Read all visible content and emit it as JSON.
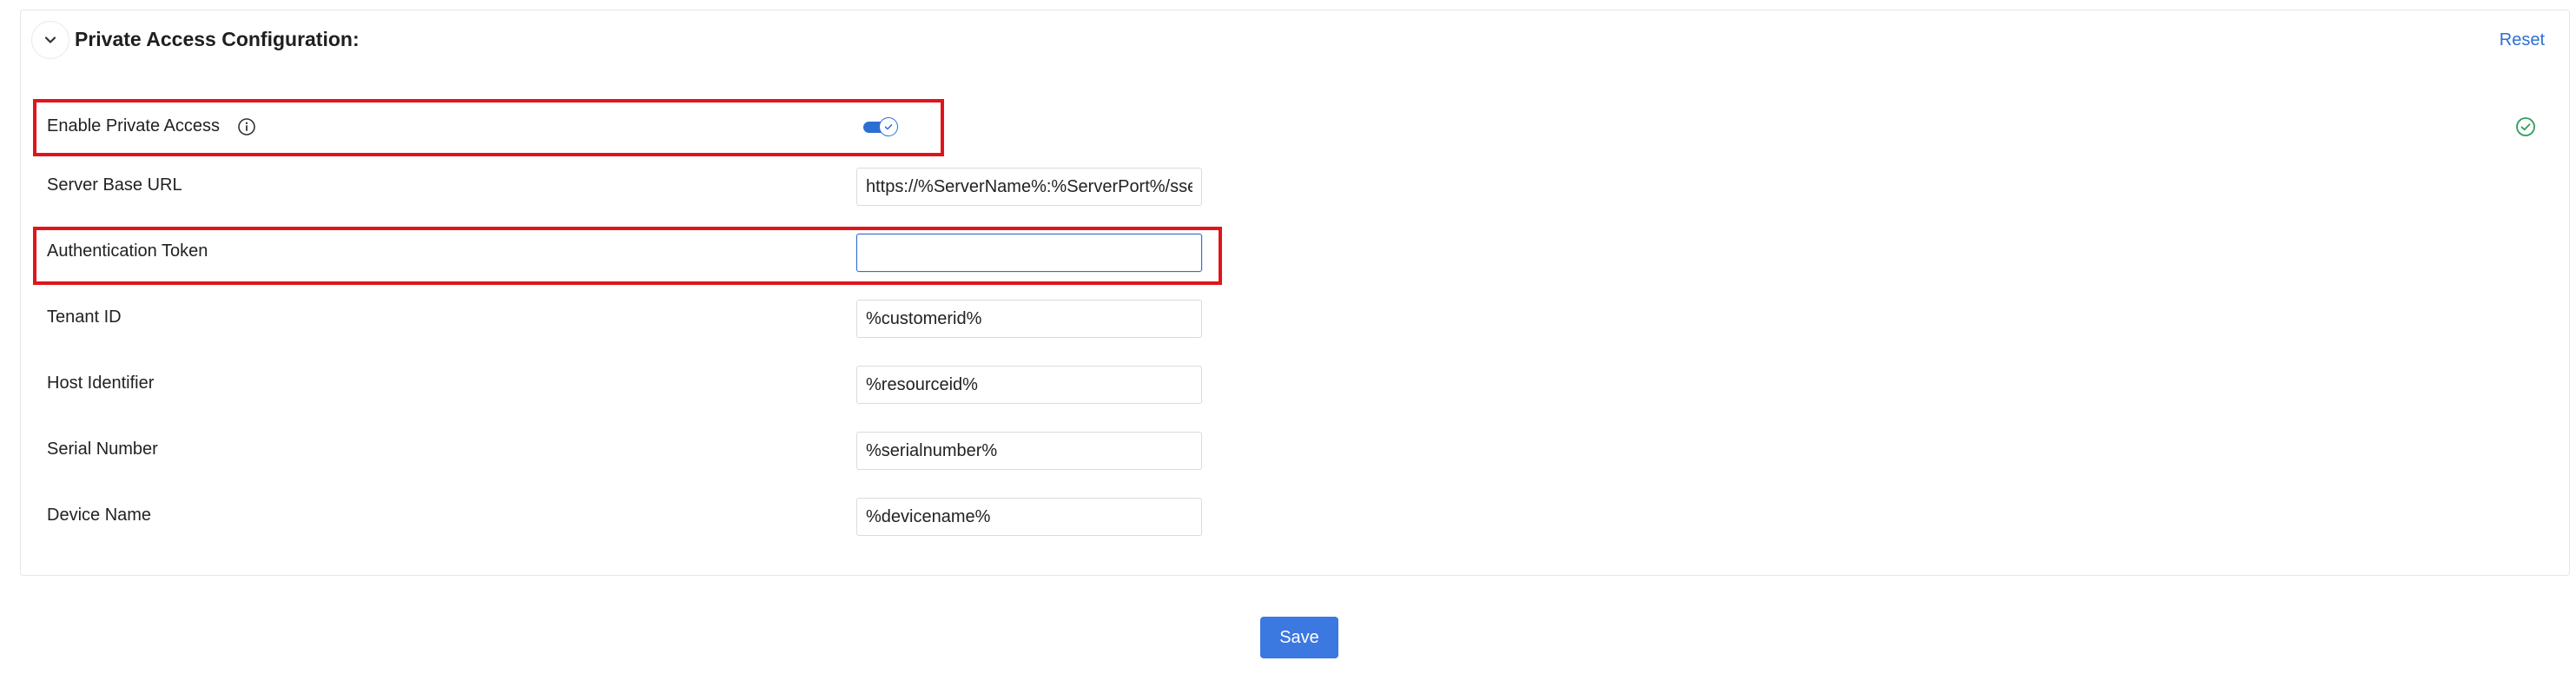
{
  "section": {
    "title": "Private Access Configuration:",
    "reset_label": "Reset",
    "collapse_icon": "chevron-down-icon",
    "status_icon": "check-circle-icon",
    "status_color": "#2e9e5b"
  },
  "fields": {
    "enable_private_access": {
      "label": "Enable Private Access",
      "icon": "info-icon",
      "enabled": true
    },
    "server_base_url": {
      "label": "Server Base URL",
      "value": "https://%ServerName%:%ServerPort%/sse/e"
    },
    "authentication_token": {
      "label": "Authentication Token",
      "value": ""
    },
    "tenant_id": {
      "label": "Tenant ID",
      "value": "%customerid%"
    },
    "host_identifier": {
      "label": "Host Identifier",
      "value": "%resourceid%"
    },
    "serial_number": {
      "label": "Serial Number",
      "value": "%serialnumber%"
    },
    "device_name": {
      "label": "Device Name",
      "value": "%devicename%"
    }
  },
  "actions": {
    "save_label": "Save"
  },
  "colors": {
    "accent": "#2c6fd4",
    "save_button": "#3b78e0",
    "highlight": "#e0151b"
  }
}
